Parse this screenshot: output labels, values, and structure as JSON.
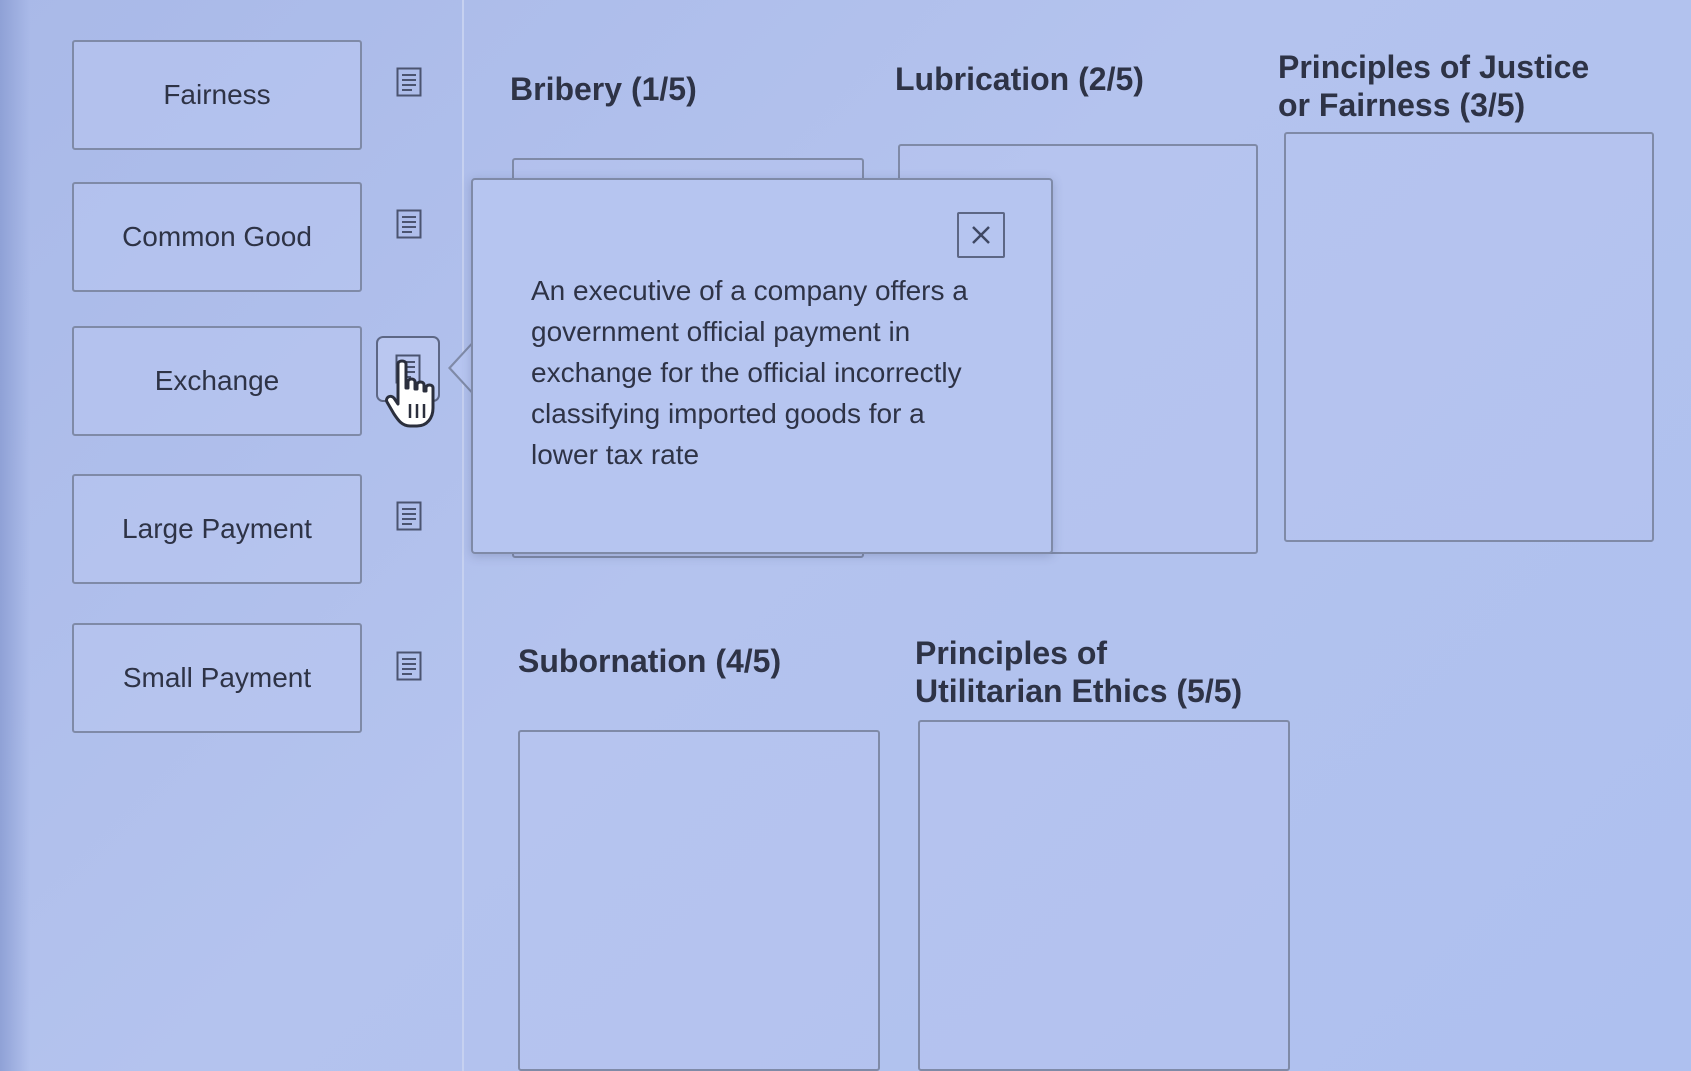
{
  "terms": [
    {
      "label": "Fairness"
    },
    {
      "label": "Common Good"
    },
    {
      "label": "Exchange"
    },
    {
      "label": "Large Payment"
    },
    {
      "label": "Small Payment"
    }
  ],
  "categories": [
    {
      "label": "Bribery (1/5)"
    },
    {
      "label": "Lubrication (2/5)"
    },
    {
      "label": "Principles of Justice or Fairness (3/5)"
    },
    {
      "label": "Subornation (4/5)"
    },
    {
      "label": "Principles of Utilitarian Ethics (5/5)"
    }
  ],
  "popover": {
    "text": "An executive of a company offers a government official payment in exchange for the official incorrectly classifying imported goods for a lower tax rate",
    "close_icon": "close-icon"
  },
  "icons": {
    "details": "document-icon",
    "cursor": "hand-cursor-icon"
  },
  "colors": {
    "background": "#b4c3ee",
    "border": "#7f8aa7",
    "text": "#2e3346"
  }
}
